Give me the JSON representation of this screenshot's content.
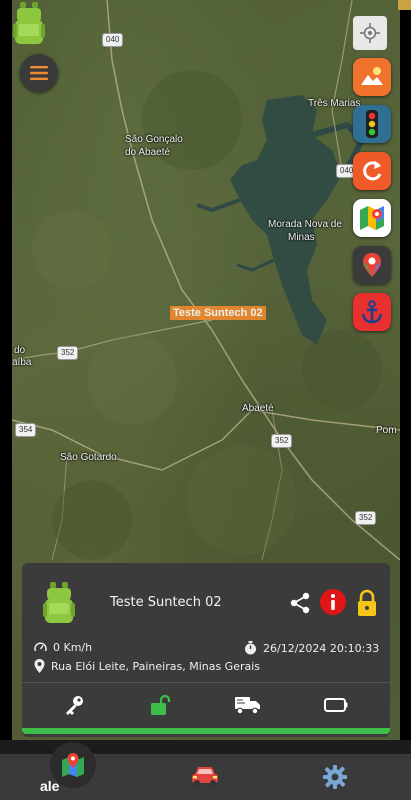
{
  "map": {
    "places": [
      {
        "id": "tres-marias",
        "text": "Três Marias"
      },
      {
        "id": "sao-goncalo-1",
        "text": "São Gonçalo"
      },
      {
        "id": "sao-goncalo-2",
        "text": "do Abaeté"
      },
      {
        "id": "morada-nova-1",
        "text": "Morada Nova de"
      },
      {
        "id": "morada-nova-2",
        "text": "Minas"
      },
      {
        "id": "abaete",
        "text": "Abaeté"
      },
      {
        "id": "sao-gotardo",
        "text": "São Gotardo"
      },
      {
        "id": "do-left",
        "text": "do"
      },
      {
        "id": "aiba-left",
        "text": "aíba"
      },
      {
        "id": "pom-right",
        "text": "Pom"
      }
    ],
    "roads": {
      "r040a": "040",
      "r040b": "040",
      "r352a": "352",
      "r352b": "352",
      "r352c": "352",
      "r354": "354"
    },
    "vehicle_label": "Teste Suntech 02"
  },
  "card": {
    "title": "Teste Suntech 02",
    "speed": "0 Km/h",
    "datetime": "26/12/2024 20:10:33",
    "address": "Rua Elói Leite, Paineiras, Minas Gerais"
  },
  "bottom_nav": {
    "edge_text": "ale"
  },
  "colors": {
    "vehicle_green": "#8dc63f",
    "alert_red": "#e01616",
    "lock_yellow": "#f5c518",
    "progress_green": "#3ebd4a",
    "label_orange": "#ef8a2d"
  },
  "icons": [
    "menu-icon",
    "crosshair-icon",
    "maps-app-icon",
    "traffic-light-icon",
    "refresh-icon",
    "google-maps-icon",
    "google-maps-nav-icon",
    "anchor-icon",
    "share-icon",
    "alert-icon",
    "lock-icon",
    "speedometer-icon",
    "stopwatch-icon",
    "location-pin-icon",
    "key-icon",
    "unlock-icon",
    "truck-icon",
    "battery-icon",
    "map-nav-icon",
    "car-nav-icon",
    "settings-icon"
  ]
}
